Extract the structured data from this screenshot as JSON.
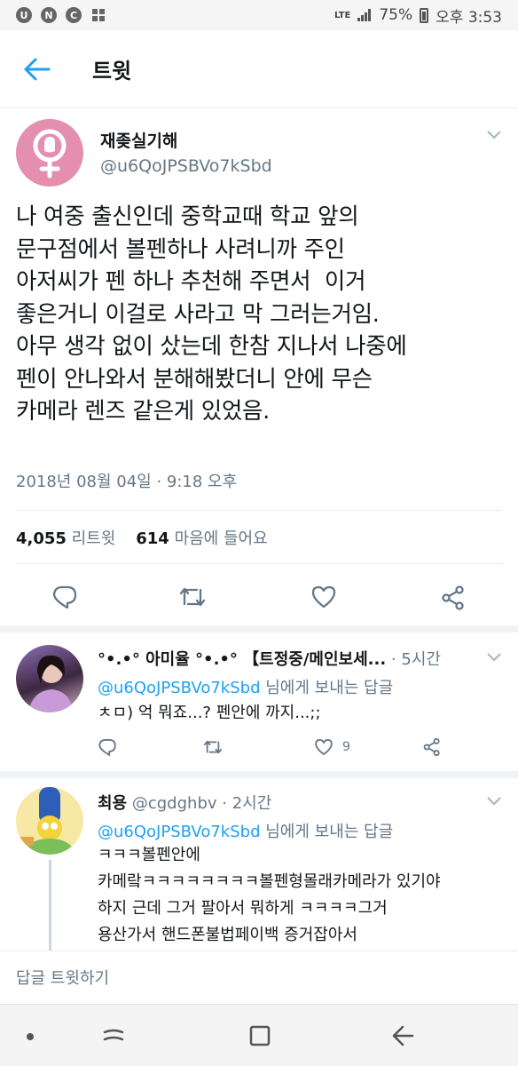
{
  "status_bar": {
    "left_icons": [
      "U",
      "N",
      "C",
      "grid"
    ],
    "lte": "LTE",
    "battery": "75%",
    "time": "오후 3:53"
  },
  "header": {
    "title": "트윗",
    "back_icon": "arrow-left-icon"
  },
  "main_tweet": {
    "author_name": "재좆실기해",
    "author_handle": "@u6QoJPSBVo7kSbd",
    "avatar_icon": "venus-fist-icon",
    "lines": [
      "나 여중 출신인데 중학교때 학교 앞의",
      "문구점에서 볼펜하나 사려니까 주인",
      "아저씨가 펜 하나 추천해 주면서  이거",
      "좋은거니 이걸로 사라고 막 그러는거임.",
      "아무 생각 없이 샀는데 한참 지나서 나중에",
      "펜이 안나와서 분해해봤더니 안에 무슨",
      "카메라 렌즈 같은게 있었음."
    ],
    "timestamp": "2018년 08월 04일 · 9:18 오후",
    "retweet_count": "4,055",
    "retweet_label": "리트윗",
    "like_count": "614",
    "like_label": "마음에 들어요"
  },
  "replies": [
    {
      "name": "°•.•° 아미율 °•.•° 【트정중/메인보세...",
      "time": "· 5시간",
      "mention": "@u6QoJPSBVo7kSbd",
      "reply_suffix": "님에게 보내는 답글",
      "lines": [
        "ㅊㅁ) 억 뭐죠...? 펜안에 까지...;;"
      ],
      "like_count": "9"
    },
    {
      "name": "최용",
      "handle": "@cgdghbv",
      "time": "· 2시간",
      "mention": "@u6QoJPSBVo7kSbd",
      "reply_suffix": "님에게 보내는 답글",
      "lines": [
        "ㅋㅋㅋ볼펜안에",
        "카메랔ㅋㅋㅋㅋㅋㅋㅋㅋ볼펜형몰래카메라가 있기야",
        "하지 근데 그거 팔아서 뭐하게 ㅋㅋㅋㅋ그거",
        "용산가서 핸드폰불법페이백 증거잡아서"
      ]
    }
  ],
  "compose": {
    "placeholder": "답글 트윗하기"
  },
  "colors": {
    "accent": "#1da1f2",
    "secondary_text": "#657786",
    "avatar_pink": "#e58faf"
  }
}
